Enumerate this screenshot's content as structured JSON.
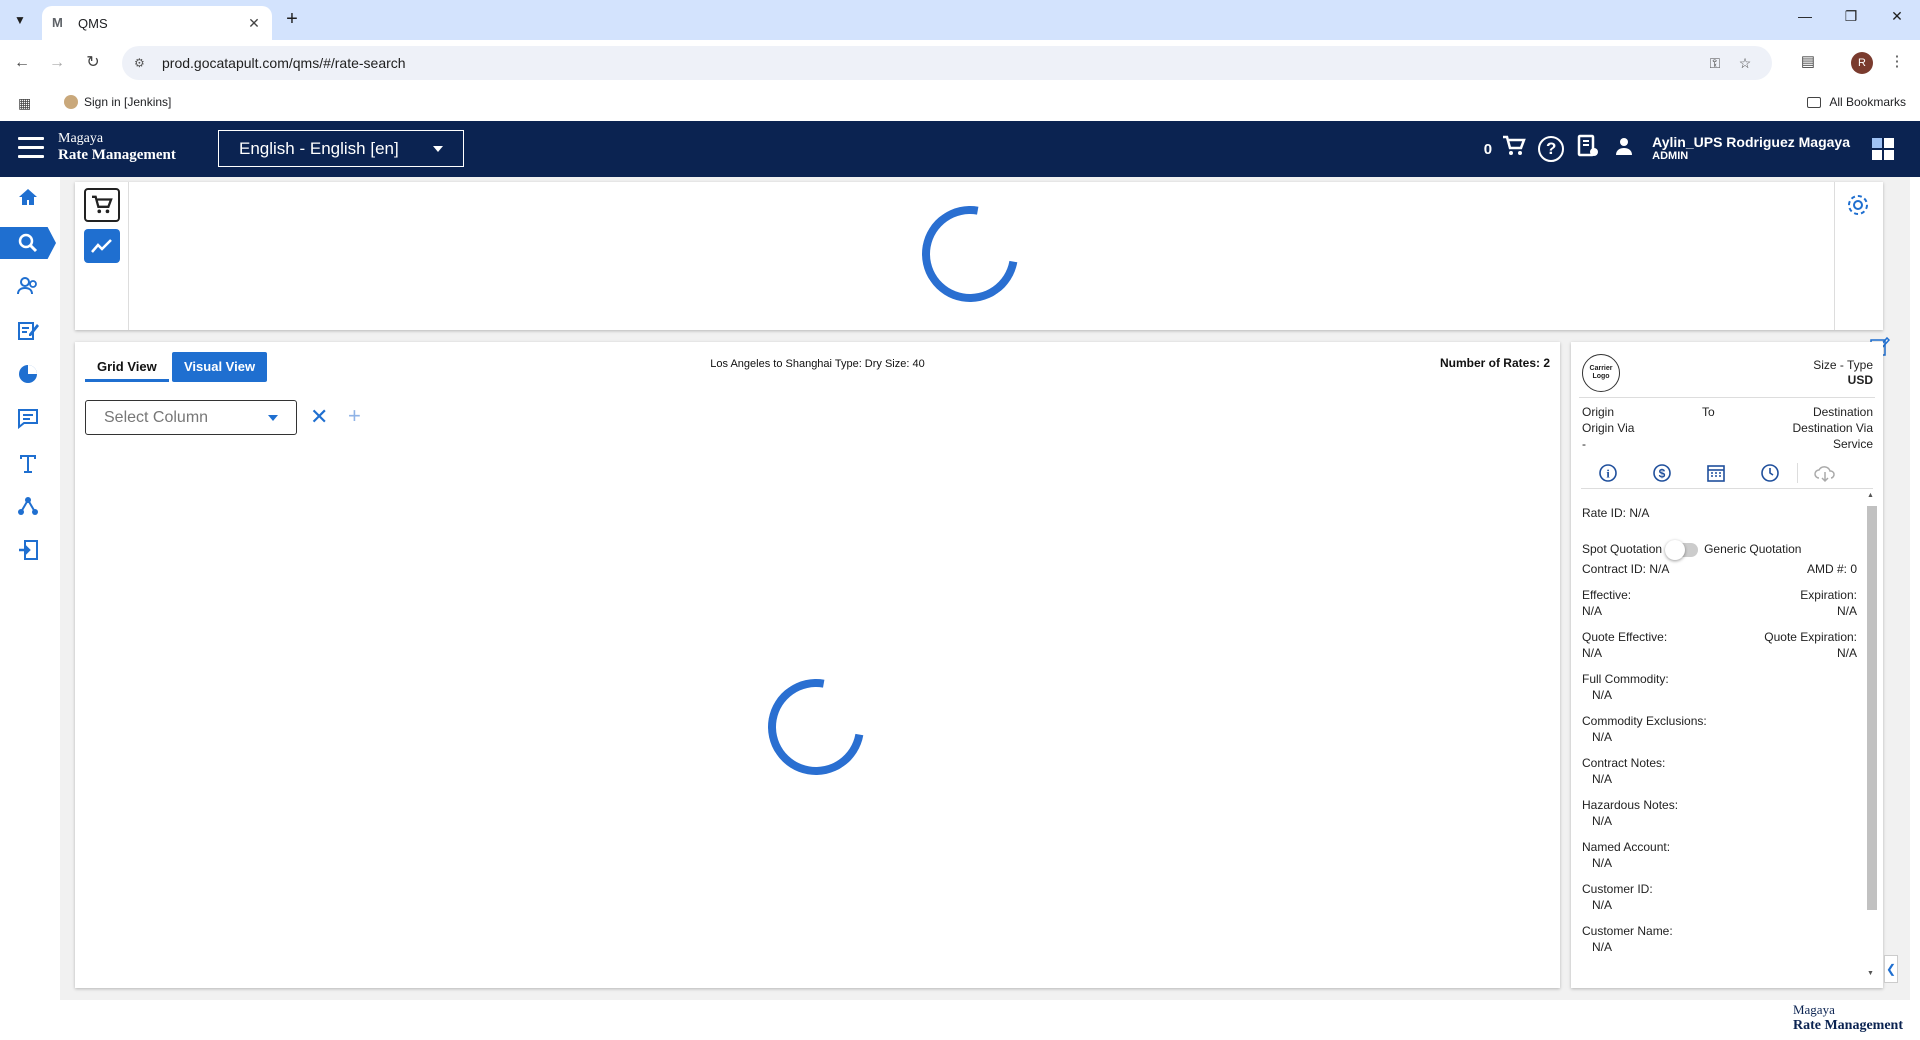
{
  "browser": {
    "tab_title": "QMS",
    "tab_favicon": "M",
    "url": "prod.gocatapult.com/qms/#/rate-search",
    "profile_initial": "R",
    "bookmarks": [
      {
        "label": "Sign in [Jenkins]"
      }
    ],
    "all_bookmarks": "All Bookmarks"
  },
  "header": {
    "brand_line1": "Magaya",
    "brand_line2": "Rate Management",
    "language": "English - English [en]",
    "cart_count": "0",
    "user_name": "Aylin_UPS Rodriguez Magaya",
    "user_role": "ADMIN"
  },
  "sidebar": {
    "items": [
      {
        "icon": "home-icon"
      },
      {
        "icon": "search-icon",
        "active": true
      },
      {
        "icon": "users-icon"
      },
      {
        "icon": "contract-edit-icon"
      },
      {
        "icon": "pie-chart-icon"
      },
      {
        "icon": "message-icon"
      },
      {
        "icon": "text-icon"
      },
      {
        "icon": "network-icon"
      },
      {
        "icon": "logout-icon"
      }
    ]
  },
  "results": {
    "grid_view_label": "Grid View",
    "visual_view_label": "Visual View",
    "route_summary": "Los Angeles to Shanghai Type: Dry Size: 40",
    "rates_count_label": "Number of Rates: 2",
    "select_column_placeholder": "Select Column"
  },
  "detail": {
    "carrier_logo_text": "Carrier Logo",
    "size_type": "Size - Type",
    "currency": "USD",
    "origin": "Origin",
    "to": "To",
    "destination": "Destination",
    "origin_via": "Origin Via",
    "destination_via": "Destination Via",
    "dash": "-",
    "service": "Service",
    "rate_id": "Rate ID: N/A",
    "spot_quotation": "Spot Quotation",
    "generic_quotation": "Generic Quotation",
    "contract_id": "Contract ID: N/A",
    "amd": "AMD #: 0",
    "effective_label": "Effective:",
    "effective_value": "N/A",
    "expiration_label": "Expiration:",
    "expiration_value": "N/A",
    "quote_effective_label": "Quote Effective:",
    "quote_effective_value": "N/A",
    "quote_expiration_label": "Quote Expiration:",
    "quote_expiration_value": "N/A",
    "fields": [
      {
        "label": "Full Commodity:",
        "value": "N/A"
      },
      {
        "label": "Commodity Exclusions:",
        "value": "N/A"
      },
      {
        "label": "Contract Notes:",
        "value": "N/A"
      },
      {
        "label": "Hazardous Notes:",
        "value": "N/A"
      },
      {
        "label": "Named Account:",
        "value": "N/A"
      },
      {
        "label": "Customer ID:",
        "value": "N/A"
      },
      {
        "label": "Customer Name:",
        "value": "N/A"
      }
    ]
  },
  "footer": {
    "brand_line1": "Magaya",
    "brand_line2": "Rate Management"
  },
  "colors": {
    "header_bg": "#0b2351",
    "accent": "#1f6fd0",
    "tab_strip": "#d3e3fd"
  }
}
